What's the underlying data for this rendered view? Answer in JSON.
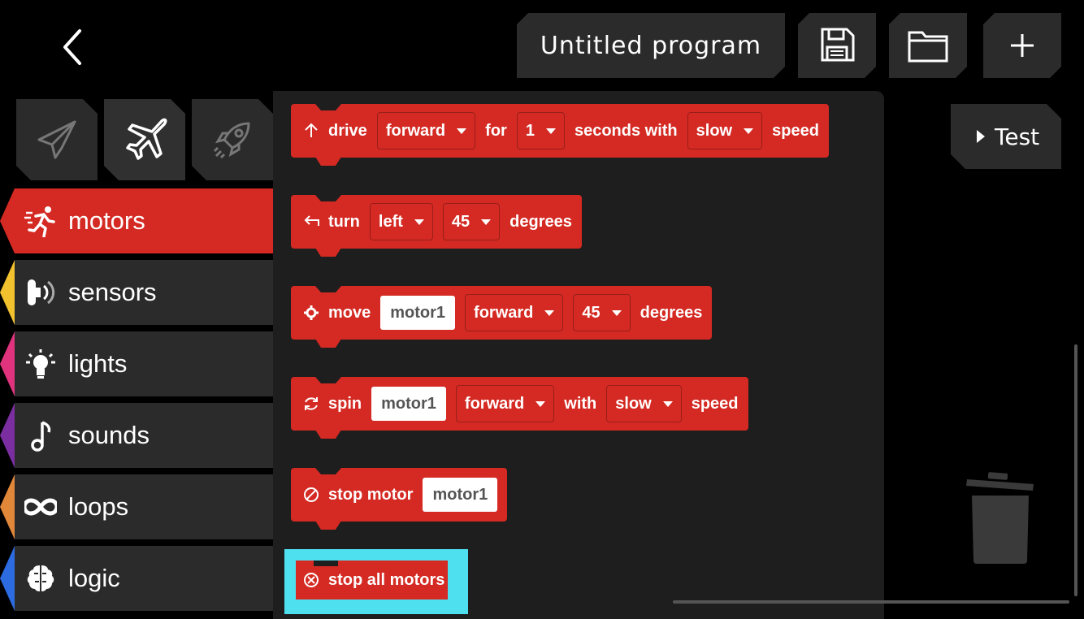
{
  "header": {
    "program_title": "Untitled program",
    "back_icon": "chevron-left-icon",
    "save_icon": "floppy-disk-icon",
    "open_icon": "folder-icon",
    "new_icon": "plus-icon"
  },
  "device_tabs": [
    {
      "icon": "paper-plane-icon",
      "active": false
    },
    {
      "icon": "airplane-icon",
      "active": true
    },
    {
      "icon": "rocket-icon",
      "active": false
    }
  ],
  "test_button": {
    "label": "Test",
    "icon": "play-icon"
  },
  "categories": [
    {
      "label": "motors",
      "color": "#d42a23",
      "icon": "running-figure-icon",
      "active": true
    },
    {
      "label": "sensors",
      "color": "#f2c12e",
      "icon": "sensor-icon",
      "active": false
    },
    {
      "label": "lights",
      "color": "#e0337d",
      "icon": "lightbulb-icon",
      "active": false
    },
    {
      "label": "sounds",
      "color": "#7a2ea0",
      "icon": "music-note-icon",
      "active": false
    },
    {
      "label": "loops",
      "color": "#e0873a",
      "icon": "infinity-icon",
      "active": false
    },
    {
      "label": "logic",
      "color": "#2d6be0",
      "icon": "brain-icon",
      "active": false
    }
  ],
  "blocks": {
    "drive": {
      "keyword": "drive",
      "direction": "forward",
      "for": "for",
      "duration": "1",
      "seconds_with": "seconds with",
      "speed_value": "slow",
      "speed": "speed",
      "icon": "arrow-up-icon"
    },
    "turn": {
      "keyword": "turn",
      "direction": "left",
      "degrees_value": "45",
      "degrees": "degrees",
      "icon": "turn-left-arrow-icon"
    },
    "move": {
      "keyword": "move",
      "motor": "motor1",
      "direction": "forward",
      "degrees_value": "45",
      "degrees": "degrees",
      "icon": "motor-gear-icon"
    },
    "spin": {
      "keyword": "spin",
      "motor": "motor1",
      "direction": "forward",
      "with": "with",
      "speed_value": "slow",
      "speed": "speed",
      "icon": "rotate-icon"
    },
    "stop_motor": {
      "keyword": "stop motor",
      "motor": "motor1",
      "icon": "no-entry-icon"
    },
    "stop_all": {
      "keyword": "stop all motors",
      "icon": "circle-x-icon",
      "highlight_color": "#4fe0f0"
    }
  },
  "trash_icon": "trash-icon",
  "colors": {
    "block": "#d42a23",
    "panel": "#1e1e1e",
    "button": "#2b2b2b"
  }
}
